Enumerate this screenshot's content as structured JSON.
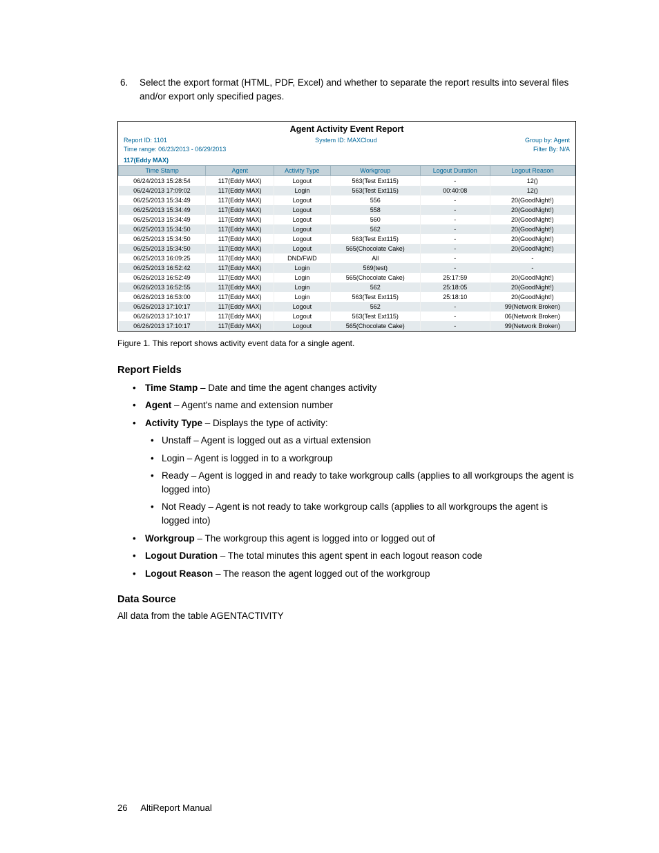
{
  "instruction": {
    "number": "6.",
    "text": "Select the export format (HTML, PDF, Excel) and whether to separate the report results into several files and/or export only specified pages."
  },
  "report": {
    "title": "Agent Activity Event Report",
    "meta_left1": "Report ID: 1101",
    "meta_center1": "System ID: MAXCloud",
    "meta_right1": "Group by: Agent",
    "meta_left2": "Time range: 06/23/2013 - 06/29/2013",
    "meta_right2": "Filter By: N/A",
    "agent_header": "117(Eddy MAX)",
    "columns": [
      "Time Stamp",
      "Agent",
      "Activity Type",
      "Workgroup",
      "Logout Duration",
      "Logout Reason"
    ],
    "rows": [
      [
        "06/24/2013 15:28:54",
        "117(Eddy MAX)",
        "Logout",
        "563(Test Ext115)",
        "-",
        "12()"
      ],
      [
        "06/24/2013 17:09:02",
        "117(Eddy MAX)",
        "Login",
        "563(Test Ext115)",
        "00:40:08",
        "12()"
      ],
      [
        "06/25/2013 15:34:49",
        "117(Eddy MAX)",
        "Logout",
        "556",
        "-",
        "20(GoodNight!)"
      ],
      [
        "06/25/2013 15:34:49",
        "117(Eddy MAX)",
        "Logout",
        "558",
        "-",
        "20(GoodNight!)"
      ],
      [
        "06/25/2013 15:34:49",
        "117(Eddy MAX)",
        "Logout",
        "560",
        "-",
        "20(GoodNight!)"
      ],
      [
        "06/25/2013 15:34:50",
        "117(Eddy MAX)",
        "Logout",
        "562",
        "-",
        "20(GoodNight!)"
      ],
      [
        "06/25/2013 15:34:50",
        "117(Eddy MAX)",
        "Logout",
        "563(Test Ext115)",
        "-",
        "20(GoodNight!)"
      ],
      [
        "06/25/2013 15:34:50",
        "117(Eddy MAX)",
        "Logout",
        "565(Chocolate Cake)",
        "-",
        "20(GoodNight!)"
      ],
      [
        "06/25/2013 16:09:25",
        "117(Eddy MAX)",
        "DND/FWD",
        "All",
        "-",
        "-"
      ],
      [
        "06/25/2013 16:52:42",
        "117(Eddy MAX)",
        "Login",
        "569(test)",
        "-",
        "-"
      ],
      [
        "06/26/2013 16:52:49",
        "117(Eddy MAX)",
        "Login",
        "565(Chocolate Cake)",
        "25:17:59",
        "20(GoodNight!)"
      ],
      [
        "06/26/2013 16:52:55",
        "117(Eddy MAX)",
        "Login",
        "562",
        "25:18:05",
        "20(GoodNight!)"
      ],
      [
        "06/26/2013 16:53:00",
        "117(Eddy MAX)",
        "Login",
        "563(Test Ext115)",
        "25:18:10",
        "20(GoodNight!)"
      ],
      [
        "06/26/2013 17:10:17",
        "117(Eddy MAX)",
        "Logout",
        "562",
        "-",
        "99(Network Broken)"
      ],
      [
        "06/26/2013 17:10:17",
        "117(Eddy MAX)",
        "Logout",
        "563(Test Ext115)",
        "-",
        "06(Network Broken)"
      ],
      [
        "06/26/2013 17:10:17",
        "117(Eddy MAX)",
        "Logout",
        "565(Chocolate Cake)",
        "-",
        "99(Network Broken)"
      ]
    ]
  },
  "caption": {
    "label": "Figure 1.",
    "text": "This report shows activity event data for a single agent."
  },
  "section1_title": "Report Fields",
  "fields": [
    {
      "name": "Time Stamp",
      "desc": "Date and time the agent changes activity"
    },
    {
      "name": "Agent",
      "desc": "Agent's name and extension number"
    },
    {
      "name": "Activity Type",
      "desc": "Displays the type of activity:",
      "sub": [
        "Unstaff – Agent is logged out as a virtual extension",
        "Login – Agent is logged in to a workgroup",
        "Ready – Agent is logged in and ready to take workgroup calls (applies to all workgroups the agent is logged into)",
        "Not Ready – Agent is not ready to take workgroup calls (applies to all workgroups the agent is logged into)"
      ]
    },
    {
      "name": "Workgroup",
      "desc": "The workgroup this agent is logged into or logged out of"
    },
    {
      "name": "Logout Duration",
      "desc": "The total minutes this agent spent in each logout reason code",
      "dash": true
    },
    {
      "name": "Logout Reason",
      "desc": "The reason the agent logged out of the workgroup"
    }
  ],
  "section2_title": "Data Source",
  "section2_text": "All data from the table AGENTACTIVITY",
  "footer": {
    "page": "26",
    "title": "AltiReport Manual"
  }
}
